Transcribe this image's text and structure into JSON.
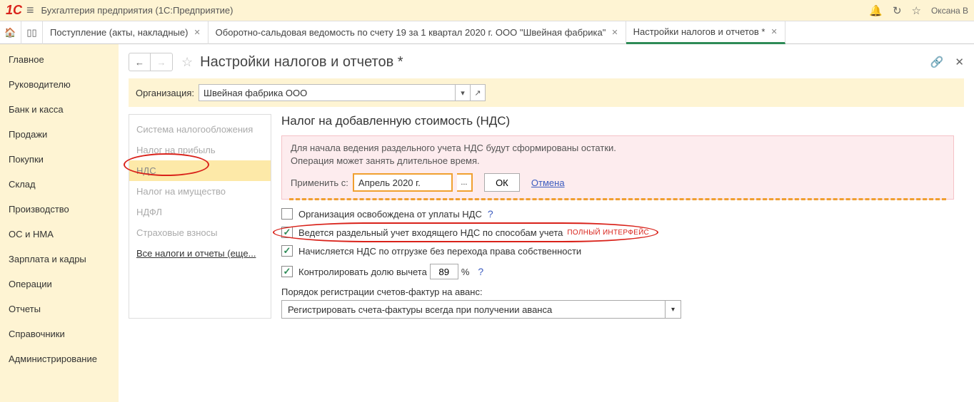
{
  "titlebar": {
    "logo_text": "1C",
    "app_title": "Бухгалтерия предприятия  (1С:Предприятие)",
    "username": "Оксана В"
  },
  "tabs": [
    {
      "label": "Поступление (акты, накладные)",
      "active": false
    },
    {
      "label": "Оборотно-сальдовая ведомость по счету 19 за 1 квартал 2020 г. ООО \"Швейная фабрика\"",
      "active": false
    },
    {
      "label": "Настройки налогов и отчетов *",
      "active": true
    }
  ],
  "nav": [
    "Главное",
    "Руководителю",
    "Банк и касса",
    "Продажи",
    "Покупки",
    "Склад",
    "Производство",
    "ОС и НМА",
    "Зарплата и кадры",
    "Операции",
    "Отчеты",
    "Справочники",
    "Администрирование"
  ],
  "page_title": "Настройки налогов и отчетов *",
  "org": {
    "label": "Организация:",
    "value": "Швейная фабрика ООО"
  },
  "categories": [
    "Система налогообложения",
    "Налог на прибыль",
    "НДС",
    "Налог на имущество",
    "НДФЛ",
    "Страховые взносы"
  ],
  "all_taxes_link": "Все налоги и отчеты (еще...",
  "panel": {
    "title": "Налог на добавленную стоимость (НДС)",
    "notice_line1": "Для начала ведения раздельного учета НДС будут сформированы остатки.",
    "notice_line2": "Операция может занять длительное время.",
    "apply_label": "Применить с:",
    "apply_date": "Апрель 2020 г.",
    "ok": "ОК",
    "cancel": "Отмена",
    "check_exempt": "Организация освобождена от уплаты НДС",
    "check_separate": "Ведется раздельный учет входящего НДС по способам учета",
    "full_interface": "ПОЛНЫЙ ИНТЕРФЕЙС",
    "check_shipping": "Начисляется НДС по отгрузке без перехода права собственности",
    "check_deduct": "Контролировать долю вычета",
    "deduct_value": "89",
    "invoice_label": "Порядок регистрации счетов-фактур на аванс:",
    "invoice_value": "Регистрировать счета-фактуры всегда при получении аванса"
  }
}
